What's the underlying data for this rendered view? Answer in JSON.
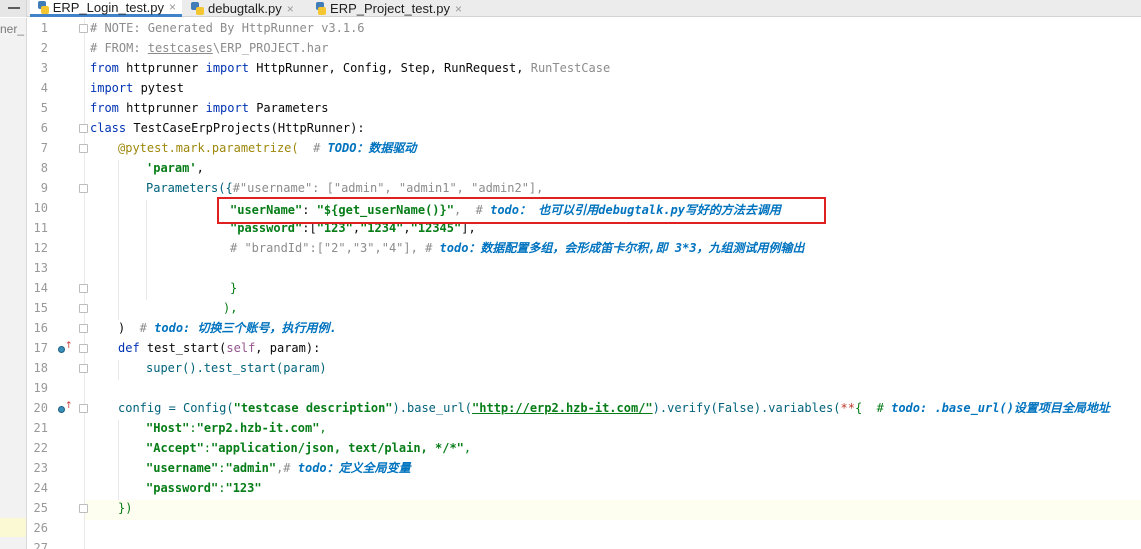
{
  "tabs": [
    {
      "label": "ERP_Login_test.py",
      "active": true,
      "close": "×"
    },
    {
      "label": "debugtalk.py",
      "active": false,
      "close": "×"
    },
    {
      "label": "ERP_Project_test.py",
      "active": false,
      "close": "×"
    }
  ],
  "sidebar": {
    "label": "ner_"
  },
  "colors": {
    "accent_tab": "#4083c9",
    "highlight_box": "#e02020",
    "todo": "#0073bf"
  },
  "line_numbers": [
    "1",
    "2",
    "3",
    "4",
    "5",
    "6",
    "7",
    "8",
    "9",
    "10",
    "11",
    "12",
    "13",
    "14",
    "15",
    "16",
    "17",
    "18",
    "19",
    "20",
    "21",
    "22",
    "23",
    "24",
    "25",
    "26",
    "27"
  ],
  "code": {
    "l1": "# NOTE: Generated By HttpRunner v3.1.6",
    "l2a": "# FROM: ",
    "l2b": "testcases",
    "l2c": "\\ERP_PROJECT.har",
    "l3a": "from",
    "l3b": " httprunner ",
    "l3c": "import",
    "l3d": " HttpRunner, Config, Step, RunRequest, ",
    "l3e": "RunTestCase",
    "l4a": "import",
    "l4b": " pytest",
    "l5a": "from",
    "l5b": " httprunner ",
    "l5c": "import",
    "l5d": " Parameters",
    "l6a": "class",
    "l6b": " TestCaseErpProjects(HttpRunner):",
    "l7a": "@pytest.mark.parametrize(",
    "l7b": "  # ",
    "l7c": "TODO：数据驱动",
    "l8a": "'param'",
    "l8b": ",",
    "l9a": "Parameters({",
    "l9b": "#\"username\": [\"admin\", \"admin1\", \"admin2\"],",
    "l10a": "\"userName\"",
    "l10b": ": ",
    "l10c": "\"${get_userName()}\"",
    "l10d": ",  # ",
    "l10e": "todo： 也可以引用debugtalk.py写好的方法去调用",
    "l11a": "\"password\"",
    "l11b": ":[",
    "l11c": "\"123\"",
    "l11d": ",",
    "l11e": "\"1234\"",
    "l11f": ",",
    "l11g": "\"12345\"",
    "l11h": "],",
    "l12a": "# \"brandId\":[\"2\",\"3\",\"4\"], # ",
    "l12b": "todo：数据配置多组，会形成笛卡尔积,即 3*3，九组测试用例输出",
    "l14": "}",
    "l15": "),",
    "l16a": ")",
    "l16b": "  # ",
    "l16c": "todo: 切换三个账号，执行用例.",
    "l17a": "def",
    "l17b": " test_start(",
    "l17c": "self",
    "l17d": ", param):",
    "l18a": "super",
    "l18b": "().test_start(param)",
    "l20a": "config = Config(",
    "l20b": "\"testcase description\"",
    "l20c": ").base_url(",
    "l20d": "\"http://erp2.hzb-it.com/\"",
    "l20e": ").verify(",
    "l20f": "False",
    "l20g": ").variables(",
    "l20h": "**",
    "l20i": "{  # ",
    "l20j": "todo: .base_url()设置项目全局地址",
    "l21a": "\"Host\"",
    "l21b": ":",
    "l21c": "\"erp2.hzb-it.com\"",
    "l21d": ",",
    "l22a": "\"Accept\"",
    "l22b": ":",
    "l22c": "\"application/json, text/plain, */*\"",
    "l22d": ",",
    "l23a": "\"username\"",
    "l23b": ":",
    "l23c": "\"admin\"",
    "l23d": ",# ",
    "l23e": "todo：定义全局变量",
    "l24a": "\"password\"",
    "l24b": ":",
    "l24c": "\"123\"",
    "l25": "})"
  }
}
